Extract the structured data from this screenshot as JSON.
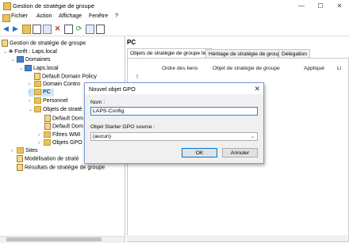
{
  "window": {
    "title": "Gestion de stratégie de groupe",
    "controls": {
      "minimize": "—",
      "maximize": "☐",
      "close": "✕"
    }
  },
  "menubar": {
    "items": [
      "Fichier",
      "Action",
      "Affichage",
      "Fenêtre",
      "?"
    ]
  },
  "tree": {
    "root": "Gestion de stratégie de groupe",
    "forest": "Forêt : Laps.local",
    "domains": "Domaines",
    "domain": "Laps.local",
    "default_domain_policy": "Default Domain Policy",
    "domain_controllers": "Domain Contro",
    "pc": "PC",
    "personnel": "Personnel",
    "gpo_objects": "Objets de straté",
    "gpo_default_1": "Default Dom",
    "gpo_default_2": "Default Dom",
    "gpo_laps": "Objets GPO Sta",
    "wmi_filters": "Filtres WMI",
    "starter_gpo": "Objets GPO Sta",
    "sites": "Sites",
    "modeling": "Modélisation de straté",
    "results": "Résultats de stratégie de groupe"
  },
  "rightpane": {
    "title": "PC",
    "tabs": [
      "Objets de stratégie de groupe liés",
      "Héritage de stratégie de groupe",
      "Délégation"
    ],
    "columns": [
      "Ordre des liens",
      "Objet de stratégie de groupe",
      "Appliqué",
      "Li"
    ]
  },
  "dialog": {
    "title": "Nouvel objet GPO",
    "name_label": "Nom :",
    "name_value": "LAPS-Config",
    "starter_label": "Objet Starter GPO source :",
    "starter_value": "(aucun)",
    "ok": "OK",
    "cancel": "Annuler"
  },
  "colors": {
    "accent": "#0078d7",
    "selection": "#cce8ff",
    "folder": "#e8c25a"
  }
}
